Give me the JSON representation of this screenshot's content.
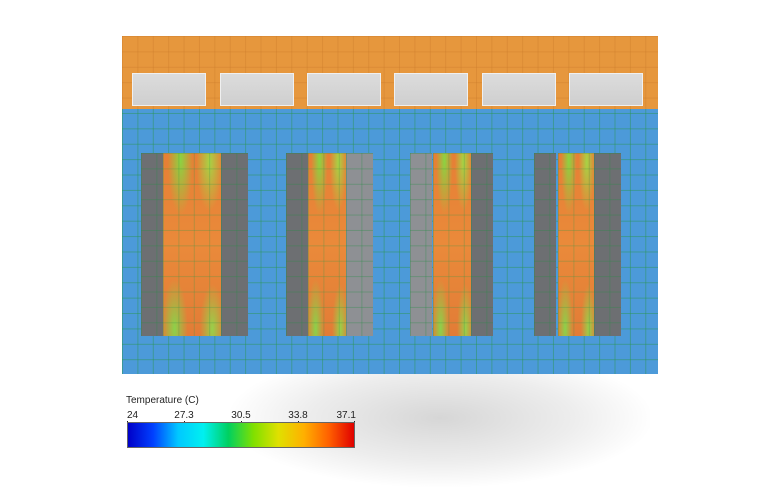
{
  "legend": {
    "title": "Temperature (C)",
    "ticks": [
      "24",
      "27.3",
      "30.5",
      "33.8",
      "37.1"
    ],
    "colormap": [
      "#0000c8",
      "#0040ff",
      "#00c8ff",
      "#00f0f0",
      "#00d060",
      "#80e000",
      "#e0e000",
      "#ffb000",
      "#ff6000",
      "#e00000"
    ]
  },
  "colors": {
    "cold_floor": "#4c9ad9",
    "hot_aisle": "#e6973d",
    "rack": "#6d6f72",
    "ceiling_unit": "#d6d6d6"
  }
}
